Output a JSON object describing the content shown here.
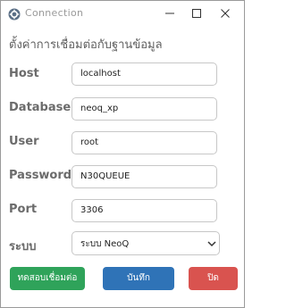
{
  "window": {
    "title": "Connection"
  },
  "heading": "ตั้งค่าการเชื่อมต่อกับฐานข้อมูล",
  "fields": {
    "host": {
      "label": "Host",
      "value": "localhost"
    },
    "database": {
      "label": "Database",
      "value": "neoq_xp"
    },
    "user": {
      "label": "User",
      "value": "root"
    },
    "password": {
      "label": "Password",
      "value": "N30QUEUE"
    },
    "port": {
      "label": "Port",
      "value": "3306"
    },
    "system": {
      "label": "ระบบ",
      "value": "ระบบ NeoQ"
    }
  },
  "buttons": {
    "test": "ทดสอบเชื่อมต่อ",
    "save": "บันทึก",
    "close": "ปิด"
  },
  "icons": {
    "app": "gear-icon",
    "minimize": "minimize-icon",
    "maximize": "maximize-icon",
    "close": "close-icon",
    "chevron": "chevron-down-icon"
  },
  "colors": {
    "test_button": "#2fa35a",
    "save_button": "#2f73b7",
    "close_button": "#d9534f"
  }
}
